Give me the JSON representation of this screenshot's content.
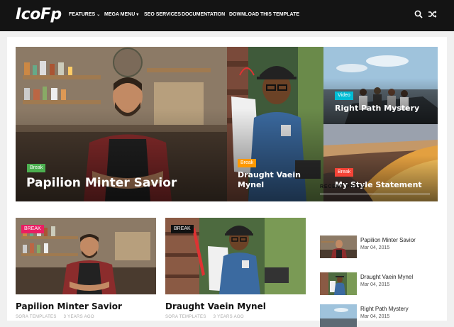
{
  "brand": {
    "logo": "IcoFp"
  },
  "nav": {
    "items": [
      {
        "label": "FEATURES",
        "caret": "⌄"
      },
      {
        "label": "MEGA MENU",
        "caret": "▾"
      },
      {
        "label": "SEO SERVICES",
        "caret": ""
      },
      {
        "label": "DOCUMENTATION",
        "caret": ""
      },
      {
        "label": "DOWNLOAD THIS TEMPLATE",
        "caret": ""
      }
    ],
    "search_icon": "search-icon",
    "shuffle_icon": "shuffle-icon"
  },
  "featured": {
    "main": {
      "label": "Break",
      "title": "Papilion Minter Savior",
      "label_color": "#4caf50"
    },
    "middle": {
      "label": "Break",
      "title": "Draught Vaein Mynel",
      "label_color": "#ff9800"
    },
    "top_right": {
      "label": "Video",
      "title": "Right Path Mystery",
      "label_color": "#00bcd4"
    },
    "bottom_right": {
      "label": "Break",
      "title": "My Style Statement",
      "label_color": "#f44336"
    }
  },
  "posts": [
    {
      "label": "BREAK",
      "label_color": "#e91e63",
      "title": "Papilion Minter Savior",
      "author": "SORA TEMPLATES",
      "time": "3 YEARS AGO"
    },
    {
      "label": "BREAK",
      "label_color": "#111111",
      "title": "Draught Vaein Mynel",
      "author": "SORA TEMPLATES",
      "time": "3 YEARS AGO"
    }
  ],
  "sidebar": {
    "heading": "RECENT POSTS",
    "items": [
      {
        "title": "Papilion Minter Savior",
        "date": "Mar 04, 2015"
      },
      {
        "title": "Draught Vaein Mynel",
        "date": "Mar 04, 2015"
      },
      {
        "title": "Right Path Mystery",
        "date": "Mar 04, 2015"
      }
    ]
  }
}
